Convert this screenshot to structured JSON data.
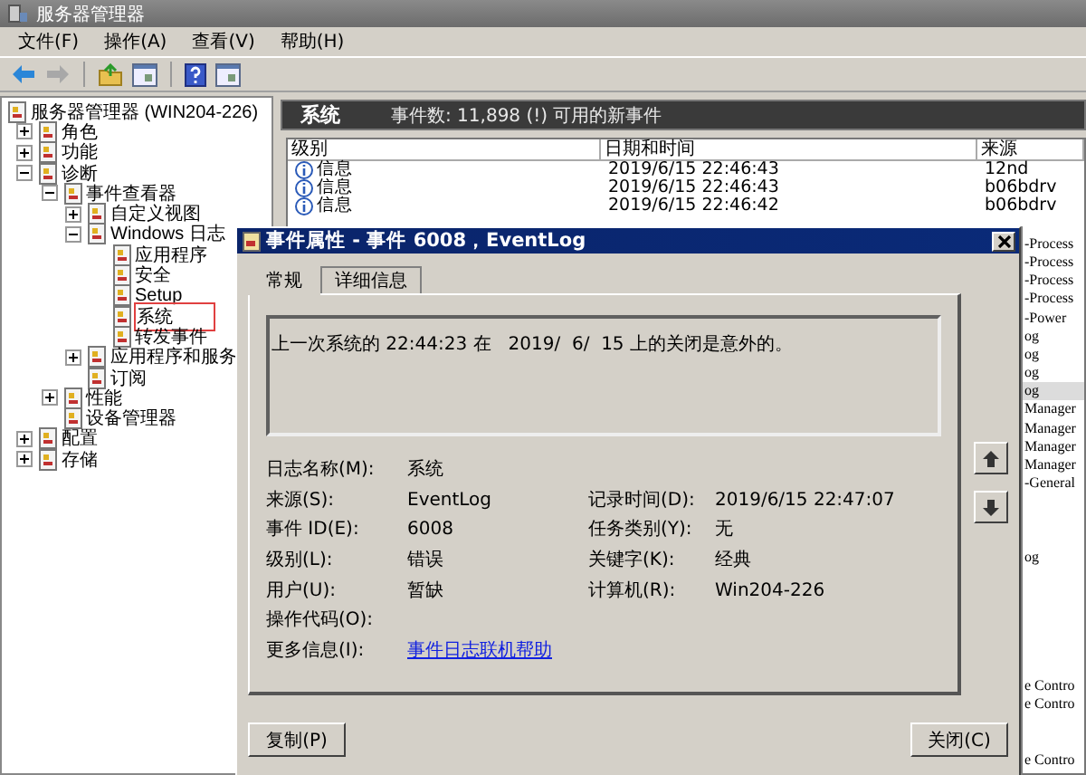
{
  "window": {
    "title": "服务器管理器"
  },
  "menu": [
    "文件(F)",
    "操作(A)",
    "查看(V)",
    "帮助(H)"
  ],
  "toolbar": [
    {
      "kind": "back",
      "disabled": false
    },
    {
      "kind": "forward",
      "disabled": true
    },
    {
      "kind": "up"
    },
    {
      "kind": "pane"
    },
    {
      "kind": "help"
    },
    {
      "kind": "pane"
    }
  ],
  "tree": {
    "label": "服务器管理器 (WIN204-226)",
    "children": [
      {
        "label": "角色",
        "expanded": false
      },
      {
        "label": "功能",
        "expanded": false
      },
      {
        "label": "诊断",
        "expanded": true,
        "children": [
          {
            "label": "事件查看器",
            "expanded": true,
            "children": [
              {
                "label": "自定义视图",
                "expanded": false
              },
              {
                "label": "Windows 日志",
                "expanded": true,
                "children": [
                  {
                    "label": "应用程序",
                    "highlighted": false
                  },
                  {
                    "label": "安全",
                    "highlighted": false
                  },
                  {
                    "label": "Setup",
                    "highlighted": false
                  },
                  {
                    "label": "系统",
                    "highlighted": true
                  },
                  {
                    "label": "转发事件",
                    "highlighted": false
                  }
                ]
              },
              {
                "label": "应用程序和服务",
                "expanded": false
              },
              {
                "label": "订阅"
              }
            ]
          },
          {
            "label": "性能",
            "expanded": false
          },
          {
            "label": "设备管理器"
          }
        ]
      },
      {
        "label": "配置",
        "expanded": false
      },
      {
        "label": "存储",
        "expanded": false
      }
    ]
  },
  "pane": {
    "title": "系统",
    "summary": "事件数: 11,898 (!) 可用的新事件"
  },
  "table": {
    "columns": [
      "级别",
      "日期和时间",
      "来源"
    ],
    "rows": [
      {
        "kind": "full",
        "selected": false,
        "level": "信息",
        "date": "2019/6/15 22:46:43",
        "source": "12nd"
      },
      {
        "kind": "full",
        "selected": false,
        "level": "信息",
        "date": "2019/6/15 22:46:43",
        "source": "b06bdrv"
      },
      {
        "kind": "full",
        "selected": false,
        "level": "信息",
        "date": "2019/6/15 22:46:42",
        "source": "b06bdrv"
      },
      {
        "kind": "partial",
        "selected": false
      },
      {
        "kind": "partial",
        "selected": false,
        "source": "-Process"
      },
      {
        "kind": "partial",
        "selected": false,
        "source": "-Process"
      },
      {
        "kind": "partial",
        "selected": false,
        "source": "-Process"
      },
      {
        "kind": "partial",
        "selected": false,
        "source": "-Process"
      },
      {
        "kind": "partial",
        "selected": false,
        "source": "-Power"
      },
      {
        "kind": "partial",
        "selected": false,
        "source": "og"
      },
      {
        "kind": "partial",
        "selected": false,
        "source": "og"
      },
      {
        "kind": "partial",
        "selected": false,
        "source": "og"
      },
      {
        "kind": "partial",
        "selected": true,
        "source": "og"
      },
      {
        "kind": "partial",
        "selected": false,
        "source": "Manager"
      },
      {
        "kind": "partial",
        "selected": false,
        "source": "Manager"
      },
      {
        "kind": "partial",
        "selected": false,
        "source": "Manager"
      },
      {
        "kind": "partial",
        "selected": false,
        "source": "Manager"
      },
      {
        "kind": "partial",
        "selected": false,
        "source": "-General"
      },
      {
        "kind": "partial",
        "selected": false
      },
      {
        "kind": "partial",
        "selected": false
      },
      {
        "kind": "partial",
        "selected": false
      },
      {
        "kind": "partial",
        "selected": false,
        "source": "og"
      },
      {
        "kind": "partial",
        "selected": false
      },
      {
        "kind": "partial",
        "selected": false
      },
      {
        "kind": "partial",
        "selected": false
      },
      {
        "kind": "partial",
        "selected": false
      },
      {
        "kind": "partial",
        "selected": false
      },
      {
        "kind": "partial",
        "selected": false
      },
      {
        "kind": "partial",
        "selected": false,
        "source": "e Contro"
      },
      {
        "kind": "partial",
        "selected": false,
        "source": "e Contro"
      },
      {
        "kind": "partial",
        "selected": false
      },
      {
        "kind": "partial",
        "selected": false
      },
      {
        "kind": "partial",
        "selected": false,
        "source": "e Contro"
      }
    ]
  },
  "dialog": {
    "title": "事件属性 - 事件 6008，EventLog",
    "tabs": [
      {
        "label": "常规",
        "selected": true
      },
      {
        "label": "详细信息",
        "selected": false
      }
    ],
    "description": "上一次系统的 22:44:23 在   2019/  6/  15 上的关闭是意外的。",
    "rows": [
      {
        "left": {
          "label": "日志名称(M):",
          "value": "系统"
        }
      },
      {
        "left": {
          "label": "来源(S):",
          "value": "EventLog"
        },
        "right": {
          "label": "记录时间(D):",
          "value": "2019/6/15 22:47:07"
        }
      },
      {
        "left": {
          "label": "事件 ID(E):",
          "value": "6008"
        },
        "right": {
          "label": "任务类别(Y):",
          "value": "无"
        }
      },
      {
        "left": {
          "label": "级别(L):",
          "value": "错误"
        },
        "right": {
          "label": "关键字(K):",
          "value": "经典"
        }
      },
      {
        "left": {
          "label": "用户(U):",
          "value": "暂缺"
        },
        "right": {
          "label": "计算机(R):",
          "value": "Win204-226"
        }
      },
      {
        "left": {
          "label": "操作代码(O):"
        }
      },
      {
        "left": {
          "label": "更多信息(I):",
          "link": "事件日志联机帮助"
        }
      }
    ],
    "buttons": [
      "复制(P)",
      "关闭(C)"
    ]
  }
}
